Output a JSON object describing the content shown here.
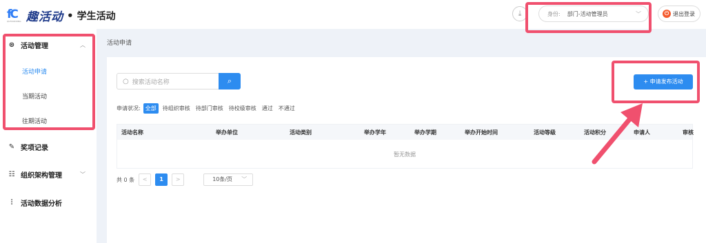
{
  "header": {
    "logo_glyph": "fC",
    "logo_tiny": "QUHUODONG",
    "brand": "趣活动",
    "dot": "•",
    "subtitle": "学生活动",
    "download_icon": "⤓",
    "identity_label": "身份:",
    "identity_value": "部门-活动管理员",
    "logout_label": "退出登录"
  },
  "sidebar": {
    "groups": [
      {
        "icon": "⊛",
        "label": "活动管理",
        "chevron": "︿"
      },
      {
        "icon": "✎",
        "label": "奖项记录"
      },
      {
        "icon": "☷",
        "label": "组织架构管理",
        "chevron": "﹀"
      },
      {
        "icon": "⫶",
        "label": "活动数据分析"
      }
    ],
    "sub_items": [
      "活动申请",
      "当期活动",
      "往期活动"
    ]
  },
  "breadcrumb": "活动申请",
  "search": {
    "placeholder": "搜索活动名称",
    "icon": "○",
    "btn_icon": "⌕"
  },
  "apply_button": "+ 申请发布活动",
  "filter": {
    "label": "申请状况:",
    "options": [
      "全部",
      "待组织审核",
      "待部门审核",
      "待校级审核",
      "通过",
      "不通过"
    ]
  },
  "table": {
    "columns": [
      "活动名称",
      "举办单位",
      "活动类别",
      "举办学年",
      "举办学期",
      "举办开始时间",
      "活动等级",
      "活动积分",
      "申请人",
      "审核"
    ],
    "empty_text": "暂无数据"
  },
  "pagination": {
    "total": "共 0 条",
    "prev": "<",
    "current": "1",
    "next": ">",
    "page_size": "10条/页"
  },
  "colors": {
    "primary": "#2d8cf0",
    "annotation": "#f0506e"
  }
}
